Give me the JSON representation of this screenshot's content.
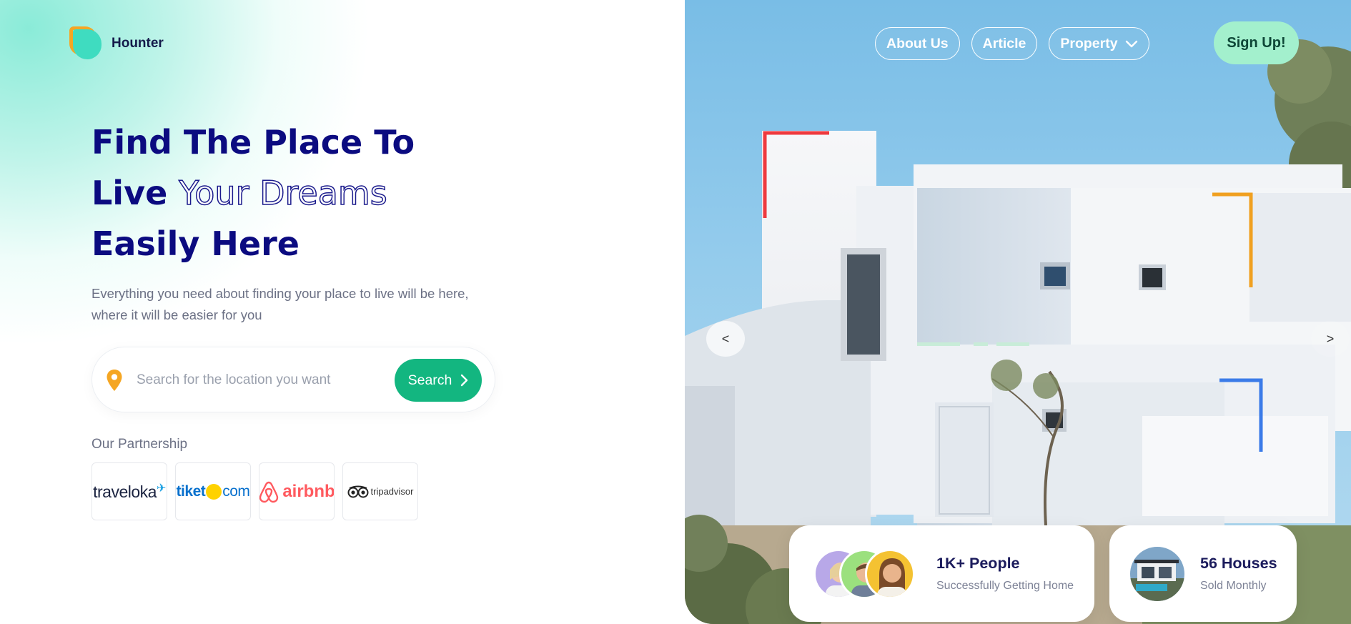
{
  "brand": {
    "name": "Hounter"
  },
  "nav": {
    "items": [
      {
        "label": "About Us"
      },
      {
        "label": "Article"
      },
      {
        "label": "Property"
      }
    ],
    "signup_label": "Sign Up!"
  },
  "hero": {
    "title_line1": "Find The Place To",
    "title_line2_solid": "Live",
    "title_line2_outline": "Your Dreams",
    "title_line3": "Easily Here",
    "description": "Everything you need about finding your place to live will be here, where it will be easier for you"
  },
  "search": {
    "placeholder": "Search for the location you want",
    "value": "",
    "button_label": "Search"
  },
  "partnership": {
    "label": "Our Partnership",
    "partners": [
      {
        "name": "traveloka"
      },
      {
        "name_a": "tiket",
        "name_b": "com"
      },
      {
        "name": "airbnb"
      },
      {
        "name": "tripadvisor"
      }
    ]
  },
  "slider": {
    "prev_label": "<",
    "next_label": ">"
  },
  "stats": {
    "people": {
      "title": "1K+ People",
      "subtitle": "Successfully Getting Home"
    },
    "houses": {
      "title": "56 Houses",
      "subtitle": "Sold Monthly"
    }
  },
  "icons": {
    "logo": "hounter-logo-icon",
    "pin": "location-pin-icon",
    "search_arrow": "chevron-right-icon",
    "dropdown": "chevron-down-icon"
  },
  "colors": {
    "primary_navy": "#0b0b80",
    "search_green": "#13b680",
    "signup_mint": "#a3f0cd",
    "pin_orange": "#f5a623"
  }
}
